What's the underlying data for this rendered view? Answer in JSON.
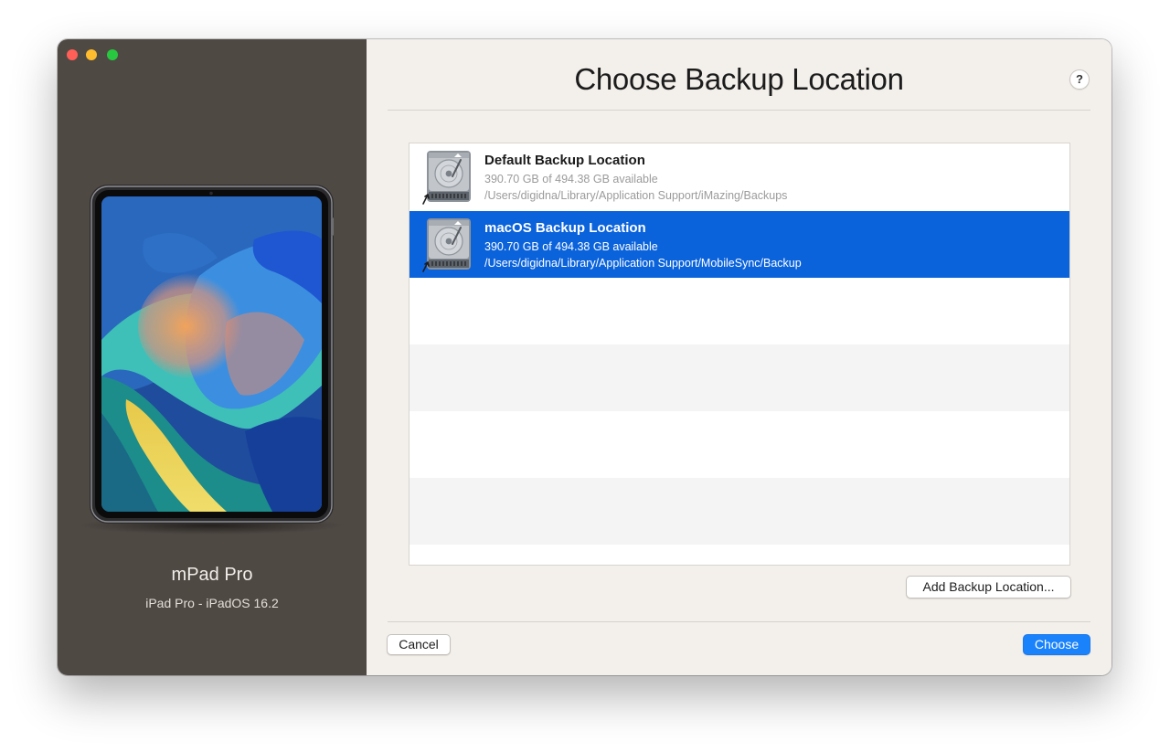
{
  "window": {
    "title": "Choose Backup Location",
    "help_label": "?"
  },
  "sidebar": {
    "device_name": "mPad Pro",
    "device_info": "iPad Pro - iPadOS 16.2"
  },
  "locations": [
    {
      "name": "Default Backup Location",
      "space": "390.70 GB of 494.38 GB available",
      "path": "/Users/digidna/Library/Application Support/iMazing/Backups",
      "selected": false,
      "icon": "hard-drive-icon"
    },
    {
      "name": "macOS Backup Location",
      "space": "390.70 GB of 494.38 GB available",
      "path": "/Users/digidna/Library/Application Support/MobileSync/Backup",
      "selected": true,
      "icon": "hard-drive-icon"
    }
  ],
  "buttons": {
    "add_location": "Add Backup Location...",
    "cancel": "Cancel",
    "choose": "Choose"
  },
  "colors": {
    "sidebar_bg": "#4f4944",
    "content_bg": "#f3efea",
    "selection": "#0b63dc",
    "primary_button": "#1a82fb",
    "traffic_close": "#ff5f57",
    "traffic_minimize": "#febc2e",
    "traffic_zoom": "#28c840"
  }
}
